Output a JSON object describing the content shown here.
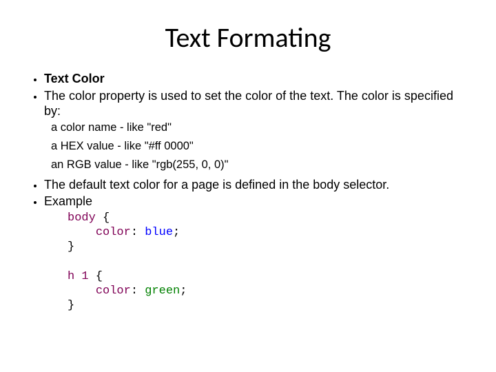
{
  "title": "Text Formating",
  "bullets": {
    "b1": "Text Color",
    "b2": "The color property is used to set the color of the text. The color is specified by:",
    "sub1": "a color name - like \"red\"",
    "sub2": "a HEX value - like \"#ff 0000\"",
    "sub3": "an RGB value - like \"rgb(255, 0, 0)\"",
    "b3": "The default text color for a page is defined in the body selector.",
    "b4": "Example"
  },
  "code": {
    "l1a": "body",
    "l1b": " {",
    "l2a": "    ",
    "l2b": "color",
    "l2c": ": ",
    "l2d": "blue",
    "l2e": ";",
    "l3": "}",
    "l5a": "h 1",
    "l5b": " {",
    "l6a": "    ",
    "l6b": "color",
    "l6c": ": ",
    "l6d": "green",
    "l6e": ";",
    "l7": "}"
  }
}
